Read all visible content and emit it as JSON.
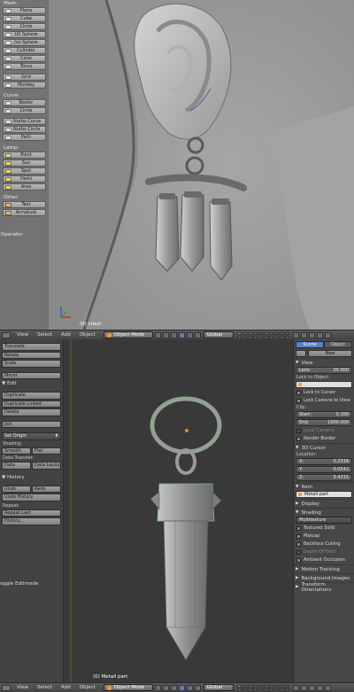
{
  "top": {
    "toolshelf": {
      "mesh_header": "Mesh:",
      "mesh": [
        "Plane",
        "Cube",
        "Circle",
        "UV Sphere",
        "Ico Sphere",
        "Cylinder",
        "Cone",
        "Torus"
      ],
      "mesh_extra": [
        "Grid",
        "Monkey"
      ],
      "curve_header": "Curve:",
      "curve": [
        "Bezier",
        "Circle"
      ],
      "curve_extra": [
        "Nurbs Curve",
        "Nurbs Circle",
        "Path"
      ],
      "lamp_header": "Lamp:",
      "lamp": [
        "Point",
        "Sun",
        "Spot",
        "Hemi",
        "Area"
      ],
      "other_header": "Other:",
      "other": [
        "Text",
        "Armature"
      ]
    },
    "operator_label": "Operator",
    "object_label": "(0) chest"
  },
  "header": {
    "menus": [
      "View",
      "Select",
      "Add",
      "Object"
    ],
    "mode": "Object Mode",
    "orientation": "Global"
  },
  "bottom": {
    "toolshelf": {
      "transform": [
        "Translate",
        "Rotate",
        "Scale"
      ],
      "mirror": "Mirror",
      "edit_header": "Edit",
      "edit": [
        "Duplicate",
        "Duplicate Linked",
        "Delete",
        "Join"
      ],
      "set_origin": "Set Origin",
      "shading_label": "Shading:",
      "shading": [
        "Smooth",
        "Flat"
      ],
      "data_transfer_label": "Data Transfer:",
      "data_transfer": [
        "Data",
        "Data Layout"
      ],
      "history_header": "History",
      "undo": "Undo",
      "redo": "Redo",
      "undo_history": "Undo History",
      "repeat_label": "Repeat:",
      "repeat_last": "Repeat Last",
      "history": "History..."
    },
    "toggle_label": "oggle Editmode",
    "object_label": "(0) Metall part"
  },
  "props": {
    "tabs": [
      "Scene",
      "Object"
    ],
    "new_button": "New",
    "view_header": "View",
    "lens_label": "Lens:",
    "lens_value": "35.000",
    "lock_to_object_label": "Lock to Object:",
    "lock_to_cursor": "Lock to Cursor",
    "lock_camera": "Lock Camera to View",
    "clip_label": "Clip:",
    "clip_start_label": "Start:",
    "clip_start": "0.100",
    "clip_end_label": "End:",
    "clip_end": "1000.000",
    "local_camera": "Local Camera",
    "render_border": "Render Border",
    "cursor_header": "3D Cursor",
    "location_label": "Location:",
    "x_label": "X:",
    "x_value": "0.2316",
    "y_label": "Y:",
    "y_value": "0.0542",
    "z_label": "Z:",
    "z_value": "3.4215",
    "item_header": "Item",
    "item_name": "Metall part",
    "display_header": "Display",
    "shading_header": "Shading",
    "shading_mode": "Multitexture",
    "shading_checks": [
      "Textured Solid",
      "Matcap",
      "Backface Culling",
      "Depth Of Field",
      "Ambient Occlusion"
    ],
    "motion_tracking": "Motion Tracking",
    "background_images": "Background Images",
    "transform_orientations": "Transform Orientations"
  }
}
